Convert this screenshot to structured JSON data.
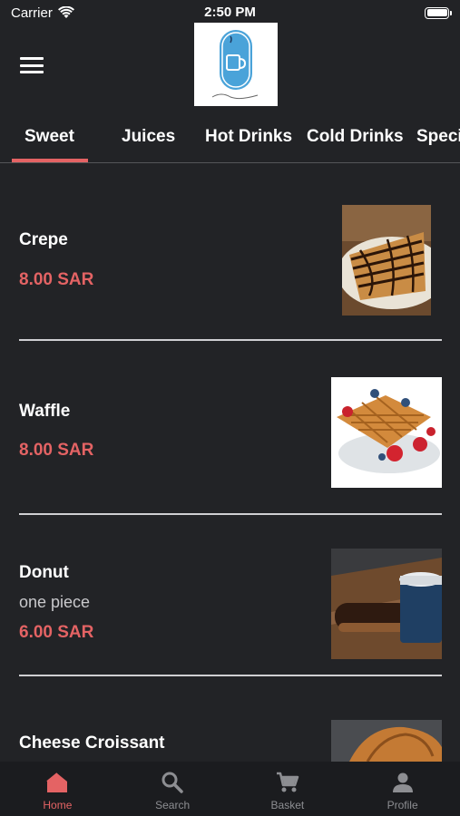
{
  "status": {
    "carrier": "Carrier",
    "time": "2:50 PM"
  },
  "header": {
    "logo_alt": "Fares o Hof"
  },
  "tabs": [
    "Sweet",
    "Juices",
    "Hot Drinks",
    "Cold Drinks",
    "Speci"
  ],
  "items": [
    {
      "name": "Crepe",
      "desc": "",
      "price": "8.00 SAR",
      "image": "crepe"
    },
    {
      "name": "Waffle",
      "desc": "",
      "price": "8.00 SAR",
      "image": "waffle"
    },
    {
      "name": "Donut",
      "desc": "one piece",
      "price": "6.00 SAR",
      "image": "donut"
    },
    {
      "name": "Cheese Croissant",
      "desc": "",
      "price": "",
      "image": "croissant"
    }
  ],
  "nav": [
    {
      "label": "Home",
      "icon": "home-icon",
      "active": true
    },
    {
      "label": "Search",
      "icon": "search-icon",
      "active": false
    },
    {
      "label": "Basket",
      "icon": "cart-icon",
      "active": false
    },
    {
      "label": "Profile",
      "icon": "person-icon",
      "active": false
    }
  ],
  "colors": {
    "accent": "#e46364",
    "background": "#222326",
    "nav_bg": "#1b1c1f"
  }
}
